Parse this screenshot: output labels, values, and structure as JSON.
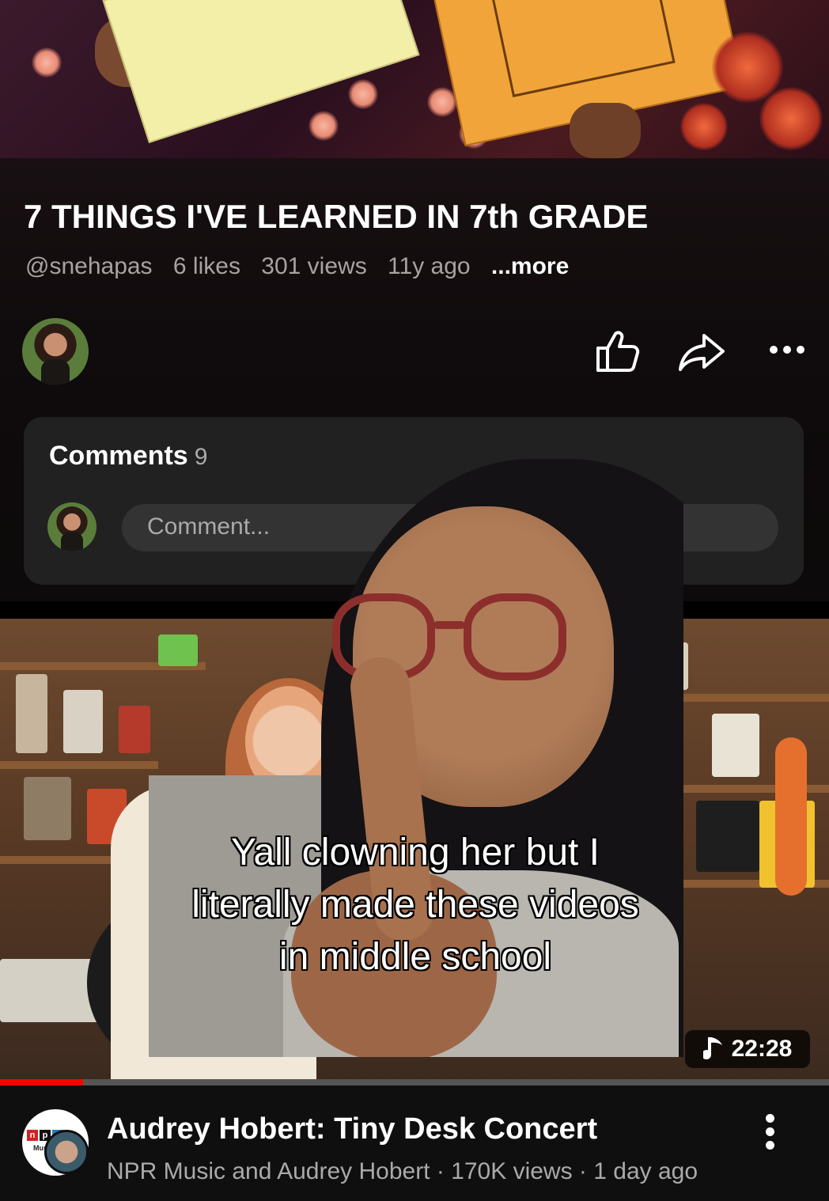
{
  "top_video": {
    "title": "7 THINGS I'VE LEARNED IN 7th GRADE",
    "channel_handle": "@snehapas",
    "likes": "6 likes",
    "views": "301 views",
    "age": "11y ago",
    "more_label": "...more"
  },
  "actions": {
    "like_icon": "thumbs-up-icon",
    "share_icon": "share-icon",
    "more_icon": "more-horizontal-icon"
  },
  "comments": {
    "label": "Comments",
    "count": "9",
    "placeholder": "Comment..."
  },
  "overlay": {
    "caption_line1": "Yall clowning her but I",
    "caption_line2": "literally made these videos",
    "caption_line3": "in middle school"
  },
  "second_video": {
    "duration": "22:28",
    "music_icon": "music-note-icon",
    "progress": 0.1,
    "title": "Audrey Hobert: Tiny Desk Concert",
    "meta": "NPR Music and Audrey Hobert · 170K views · 1 day ago",
    "channel_logo_text": [
      "n",
      "p",
      "r"
    ],
    "channel_logo_sub": "Music",
    "more_icon": "more-vertical-icon"
  },
  "colors": {
    "progress_red": "#ff0000",
    "npr_red": "#d62021",
    "npr_blue": "#237bbd"
  }
}
